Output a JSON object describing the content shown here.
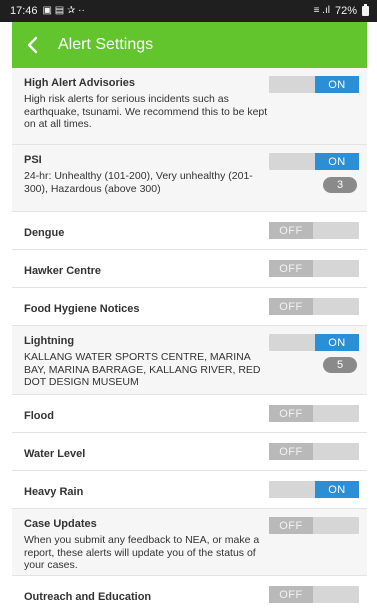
{
  "statusbar": {
    "time": "17:46",
    "left_glyphs": "▣ ▤ ✰ ··",
    "signal": "≡ .ıl",
    "battery": "72%"
  },
  "appbar": {
    "title": "Alert Settings"
  },
  "rows": [
    {
      "title": "High Alert Advisories",
      "desc": "High risk alerts for serious incidents such as earthquake, tsunami. We recommend this to be kept on at all times.",
      "toggle": "ON"
    },
    {
      "title": "PSI",
      "desc": "24-hr: Unhealthy (101-200), Very unhealthy (201-300), Hazardous (above 300)",
      "toggle": "ON",
      "badge": "3"
    },
    {
      "title": "Dengue",
      "toggle": "OFF"
    },
    {
      "title": "Hawker Centre",
      "toggle": "OFF"
    },
    {
      "title": "Food Hygiene Notices",
      "toggle": "OFF"
    },
    {
      "title": "Lightning",
      "desc": "KALLANG WATER SPORTS CENTRE, MARINA BAY, MARINA BARRAGE, KALLANG RIVER, RED DOT DESIGN MUSEUM",
      "toggle": "ON",
      "badge": "5"
    },
    {
      "title": "Flood",
      "toggle": "OFF"
    },
    {
      "title": "Water Level",
      "toggle": "OFF"
    },
    {
      "title": "Heavy Rain",
      "toggle": "ON"
    },
    {
      "title": "Case Updates",
      "desc": "When you submit any feedback to NEA, or make a report, these alerts will update you of the status of your cases.",
      "toggle": "OFF"
    },
    {
      "title": "Outreach and Education",
      "toggle": "OFF"
    }
  ]
}
